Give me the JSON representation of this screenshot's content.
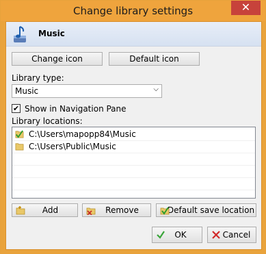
{
  "window": {
    "title": "Change library settings",
    "close_glyph": "✕"
  },
  "header": {
    "library_name": "Music",
    "icon": "music-library-icon"
  },
  "buttons": {
    "change_icon": "Change icon",
    "default_icon": "Default icon",
    "add": "Add",
    "remove": "Remove",
    "default_save_location": "Default save location",
    "ok": "OK",
    "cancel": "Cancel"
  },
  "library_type": {
    "label": "Library type:",
    "value": "Music"
  },
  "navigation": {
    "label": "Show in Navigation Pane",
    "checked": true
  },
  "locations": {
    "label": "Library locations:",
    "items": [
      {
        "path": "C:\\Users\\mapopp84\\Music",
        "default": true
      },
      {
        "path": "C:\\Users\\Public\\Music",
        "default": false
      }
    ]
  },
  "colors": {
    "accent": "#efa43d",
    "close": "#c7423b"
  }
}
